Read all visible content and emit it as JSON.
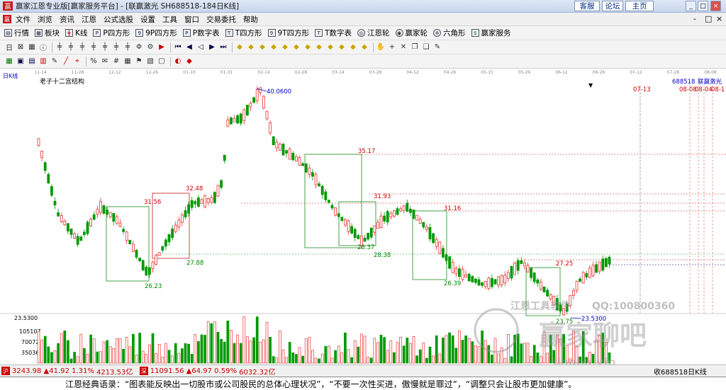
{
  "window": {
    "title": "赢家江恩专业版[赢家服务平台] - [联赢激光  SH688518-184日K线]",
    "logo_char": "赢",
    "top_buttons": [
      "客服",
      "论坛",
      "主页"
    ],
    "controls": [
      "_",
      "□",
      "×"
    ],
    "menu_controls": [
      "-",
      "□",
      "×"
    ]
  },
  "menu": {
    "items": [
      "文件",
      "浏览",
      "资讯",
      "江恩",
      "公式选股",
      "设置",
      "工具",
      "窗口",
      "交易委托",
      "帮助"
    ]
  },
  "toolbar1": {
    "items": [
      "行情",
      "板块",
      "K线",
      "P四方形",
      "9P四方形",
      "P数字表",
      "T四方形",
      "9T四方形",
      "T数字表",
      "江恩轮",
      "赢家轮",
      "六角形",
      "赢家服务"
    ]
  },
  "toolbar2": {
    "icons": [
      {
        "name": "period-icon",
        "glyph": "日"
      },
      {
        "name": "zoom-icon",
        "glyph": "⊠"
      },
      {
        "name": "layout-icon",
        "glyph": "▦"
      },
      {
        "name": "info-icon",
        "glyph": "ⓘ"
      },
      {
        "name": "kline-icon-1",
        "glyph": "╪"
      },
      {
        "name": "kline-icon-2",
        "glyph": "╪"
      },
      {
        "name": "kline-icon-3",
        "glyph": "╪"
      },
      {
        "name": "kline-icon-4",
        "glyph": "╪"
      },
      {
        "name": "kline-icon-5",
        "glyph": "╪"
      },
      {
        "name": "kline-icon-6",
        "glyph": "╪"
      },
      {
        "name": "kline-icon-7",
        "glyph": "╪"
      },
      {
        "name": "weight-icon",
        "glyph": "Φ"
      },
      {
        "name": "settings-icon",
        "glyph": "⚙"
      },
      {
        "name": "flag-icon",
        "glyph": "▶"
      },
      {
        "name": "first-icon",
        "glyph": "⏮"
      },
      {
        "name": "prev-icon",
        "glyph": "◀"
      },
      {
        "name": "back-icon",
        "glyph": "◁"
      },
      {
        "name": "next-icon",
        "glyph": "▶"
      },
      {
        "name": "last-icon",
        "glyph": "⏭"
      }
    ],
    "gold_icons": 12,
    "tail_icons": [
      {
        "name": "hand-icon",
        "glyph": "✋"
      },
      {
        "name": "plus-icon",
        "glyph": "+"
      },
      {
        "name": "cross-icon",
        "glyph": "✕"
      },
      {
        "name": "copy-icon",
        "glyph": "❐"
      },
      {
        "name": "paste-icon",
        "glyph": "❏"
      },
      {
        "name": "tool-icon",
        "glyph": "✎"
      }
    ]
  },
  "toolbar3": {
    "icons": [
      "table-icon",
      "save-icon",
      "print-icon",
      "car-icon",
      "draw-icon",
      "ruler-icon",
      "gann-icon",
      "percent-icon",
      "note-icon",
      "hash-icon",
      "grid-icon",
      "mark-icon",
      "fill-icon",
      "box-icon",
      "color-icon",
      "flag-icon"
    ]
  },
  "chart": {
    "period_label": "日K线",
    "indicator_label": "老子十二宫结构",
    "symbol": "688518",
    "name": "联赢激光",
    "date_ticks": [
      "11-14",
      "11-28",
      "12-12",
      "12-26",
      "01-10",
      "01-31",
      "02-14",
      "02-28",
      "03-14",
      "03-28",
      "04-12",
      "04-26",
      "05-15",
      "05-29",
      "06-12",
      "06-26",
      "07-12",
      "07-28",
      "08-08"
    ],
    "future_dates": [
      "07-13",
      "08-08",
      "08-04",
      "08-1"
    ],
    "price_labels": [
      {
        "text": "40.0600",
        "color": "#0000cc"
      },
      {
        "text": "35.17",
        "color": "#cc0000"
      },
      {
        "text": "32.48",
        "color": "#cc0000"
      },
      {
        "text": "31.93",
        "color": "#cc0000"
      },
      {
        "text": "31.56",
        "color": "#cc0000"
      },
      {
        "text": "31.16",
        "color": "#cc0000"
      },
      {
        "text": "28.37",
        "color": "#008800"
      },
      {
        "text": "28.38",
        "color": "#008800"
      },
      {
        "text": "27.88",
        "color": "#008800"
      },
      {
        "text": "27.25",
        "color": "#cc0000"
      },
      {
        "text": "26.39",
        "color": "#008800"
      },
      {
        "text": "26.23",
        "color": "#008800"
      },
      {
        "text": "23.75",
        "color": "#008800"
      },
      {
        "text": "23.5300",
        "color": "#0000cc"
      }
    ],
    "volume_axis": [
      "23.5300",
      "105107",
      "70072",
      "35036"
    ],
    "watermark": [
      "江恩工具软件",
      "QQ:100800360",
      "赢家聊吧",
      "jiaoba.vip"
    ]
  },
  "statusbar": {
    "index1": "3243.98",
    "index1_change": "▲41.92",
    "index1_pct": "1.31%",
    "index1_amount": "4213.53亿",
    "index2": "11091.56",
    "index2_change": "▲64.97",
    "index2_pct": "0.59%",
    "index2_amount": "6032.32亿",
    "right_text": "收688518日K线"
  },
  "quote": {
    "text": "江恩经典语录：“图表能反映出一切股市或公司股民的总体心理状况”，“不要一次性买进，傲慢就是罪过”，“调整只会让股市更加健康”。"
  }
}
